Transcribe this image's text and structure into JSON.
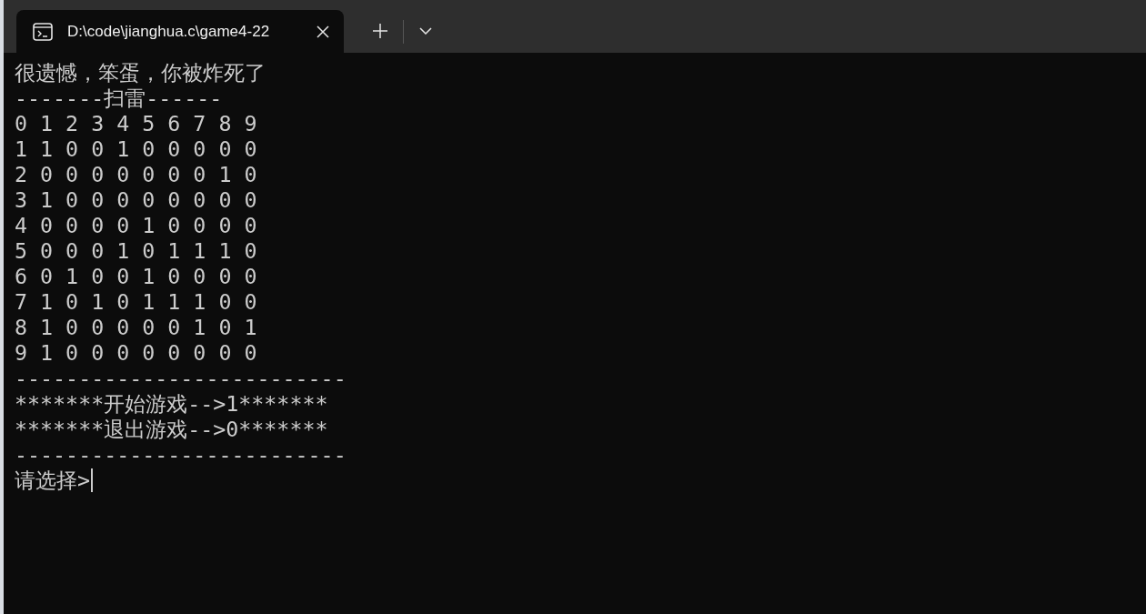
{
  "tabs": [
    {
      "title": "D:\\code\\jianghua.c\\game4-22",
      "selected": true
    }
  ],
  "terminal": {
    "lines": [
      "很遗憾，笨蛋，你被炸死了",
      "-------扫雷------",
      "0 1 2 3 4 5 6 7 8 9",
      "1 1 0 0 1 0 0 0 0 0",
      "2 0 0 0 0 0 0 0 1 0",
      "3 1 0 0 0 0 0 0 0 0",
      "4 0 0 0 0 1 0 0 0 0",
      "5 0 0 0 1 0 1 1 1 0",
      "6 0 1 0 0 1 0 0 0 0",
      "7 1 0 1 0 1 1 1 0 0",
      "8 1 0 0 0 0 0 1 0 1",
      "9 1 0 0 0 0 0 0 0 0",
      "--------------------------",
      "*******开始游戏-->1*******",
      "*******退出游戏-->0*******",
      "--------------------------"
    ],
    "prompt": "请选择>"
  }
}
